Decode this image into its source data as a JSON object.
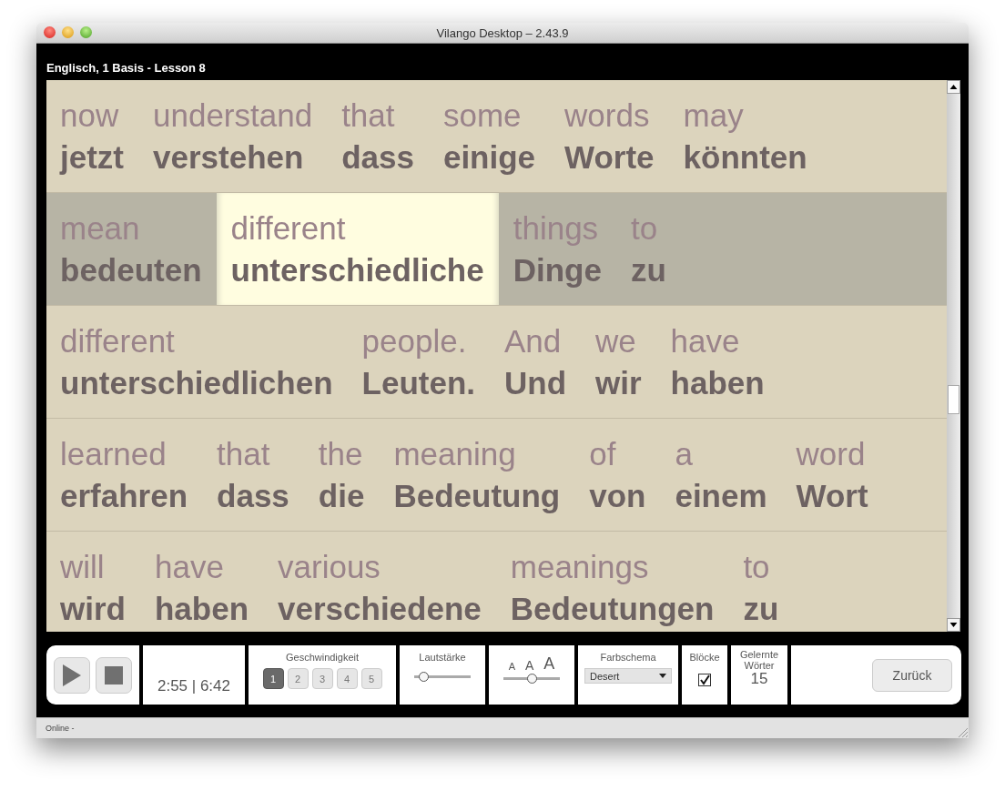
{
  "window": {
    "title": "Vilango Desktop – 2.43.9"
  },
  "lesson_title": "Englisch, 1 Basis - Lesson 8",
  "rows": [
    {
      "selected": false,
      "words": [
        {
          "source": "now",
          "translation": "jetzt",
          "selected": false
        },
        {
          "source": "understand",
          "translation": "verstehen",
          "selected": false
        },
        {
          "source": "that",
          "translation": "dass",
          "selected": false
        },
        {
          "source": "some",
          "translation": "einige",
          "selected": false
        },
        {
          "source": "words",
          "translation": "Worte",
          "selected": false
        },
        {
          "source": "may",
          "translation": "könnten",
          "selected": false
        }
      ]
    },
    {
      "selected": true,
      "words": [
        {
          "source": "mean",
          "translation": "bedeuten",
          "selected": false
        },
        {
          "source": "different",
          "translation": "unterschiedliche",
          "selected": true
        },
        {
          "source": "things",
          "translation": "Dinge",
          "selected": false
        },
        {
          "source": "to",
          "translation": "zu",
          "selected": false
        }
      ]
    },
    {
      "selected": false,
      "words": [
        {
          "source": "different",
          "translation": "unterschiedlichen",
          "selected": false
        },
        {
          "source": "people.",
          "translation": "Leuten.",
          "selected": false
        },
        {
          "source": "And",
          "translation": "Und",
          "selected": false
        },
        {
          "source": "we",
          "translation": "wir",
          "selected": false
        },
        {
          "source": "have",
          "translation": "haben",
          "selected": false
        }
      ]
    },
    {
      "selected": false,
      "words": [
        {
          "source": "learned",
          "translation": "erfahren",
          "selected": false
        },
        {
          "source": "that",
          "translation": "dass",
          "selected": false
        },
        {
          "source": "the",
          "translation": "die",
          "selected": false
        },
        {
          "source": "meaning",
          "translation": "Bedeutung",
          "selected": false
        },
        {
          "source": "of",
          "translation": "von",
          "selected": false
        },
        {
          "source": "a",
          "translation": "einem",
          "selected": false
        },
        {
          "source": "word",
          "translation": "Wort",
          "selected": false
        }
      ]
    },
    {
      "selected": false,
      "words": [
        {
          "source": "will",
          "translation": "wird",
          "selected": false
        },
        {
          "source": "have",
          "translation": "haben",
          "selected": false
        },
        {
          "source": "various",
          "translation": "verschiedene",
          "selected": false
        },
        {
          "source": "meanings",
          "translation": "Bedeutungen",
          "selected": false
        },
        {
          "source": "to",
          "translation": "zu",
          "selected": false
        }
      ]
    }
  ],
  "toolbar": {
    "time": "2:55 | 6:42",
    "speed": {
      "label": "Geschwindigkeit",
      "options": [
        {
          "label": "1",
          "selected": true
        },
        {
          "label": "2",
          "selected": false
        },
        {
          "label": "3",
          "selected": false
        },
        {
          "label": "4",
          "selected": false
        },
        {
          "label": "5",
          "selected": false
        }
      ]
    },
    "volume": {
      "label": "Lautstärke",
      "level": 0.1
    },
    "font_size": {
      "labels": [
        "A",
        "A",
        "A"
      ],
      "level": 0.5
    },
    "color_scheme": {
      "label": "Farbschema",
      "value": "Desert"
    },
    "blocks": {
      "label": "Blöcke",
      "checked": true
    },
    "learned_words": {
      "label": "Gelernte Wörter",
      "count": "15"
    },
    "back_button": "Zurück"
  },
  "status_bar": "Online -"
}
